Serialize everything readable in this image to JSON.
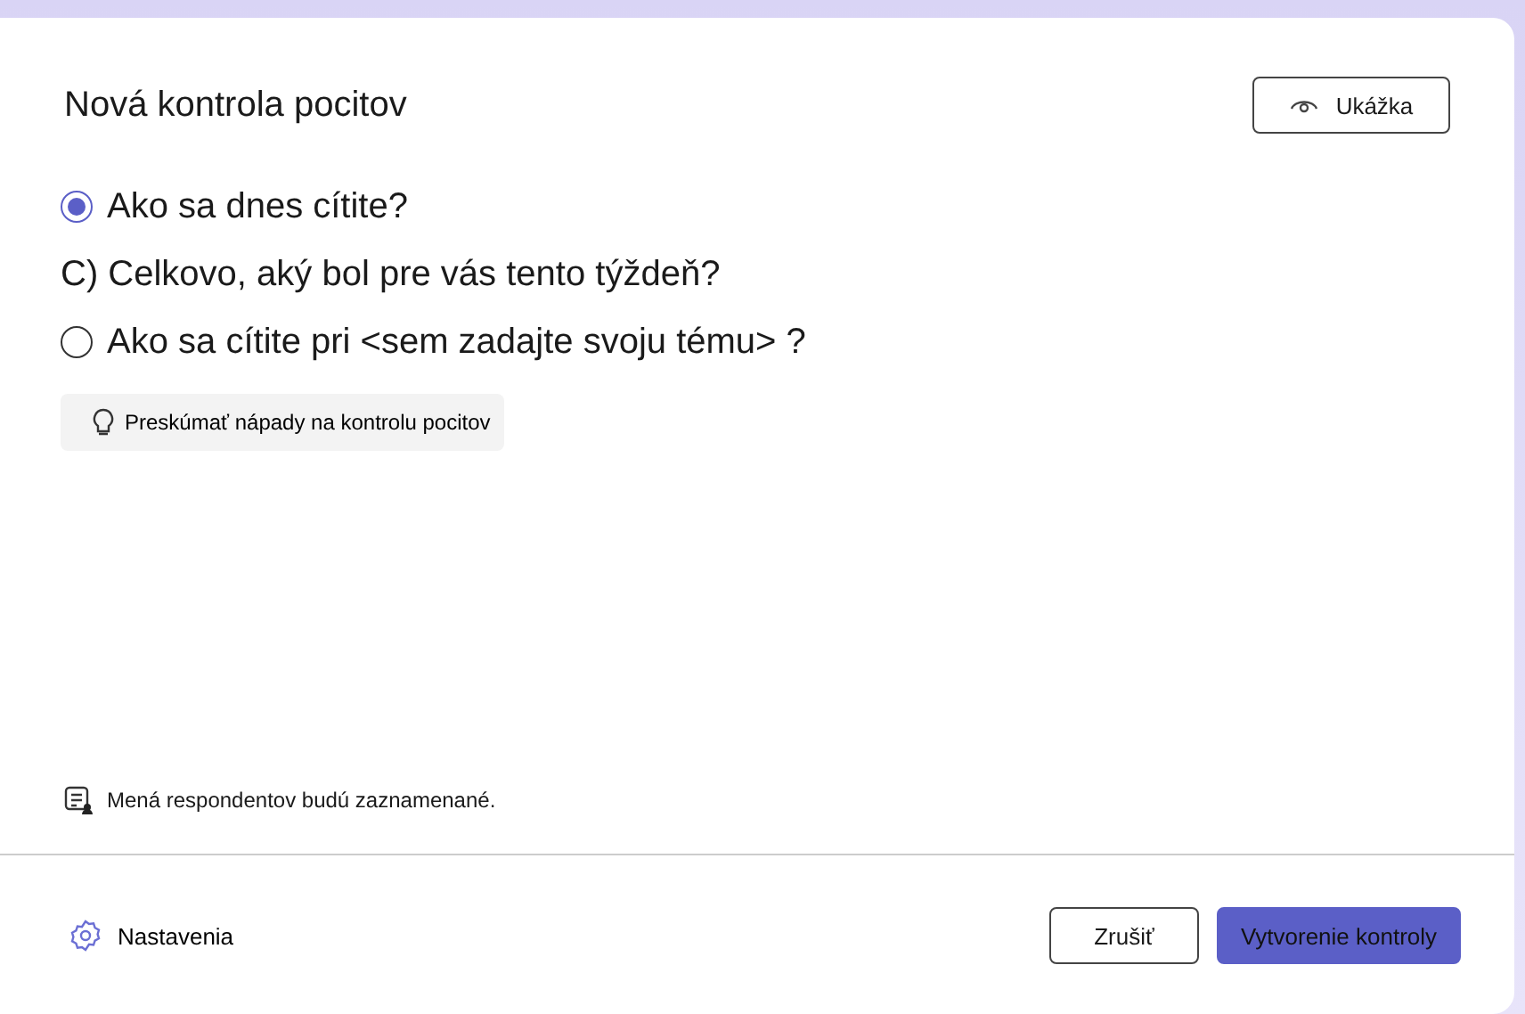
{
  "dialog": {
    "title": "Nová kontrola pocitov",
    "preview_button": "Ukážka"
  },
  "questions": [
    {
      "kind": "radio",
      "label": "Ako sa dnes cítite?",
      "selected": true
    },
    {
      "kind": "text",
      "label": "C) Celkovo, aký bol pre vás tento týždeň?"
    },
    {
      "kind": "radio",
      "label": "Ako sa cítite pri <sem zadajte svoju tému> ?",
      "selected": false
    }
  ],
  "ideas_button": "Preskúmať nápady na kontrolu pocitov",
  "note": "Mená respondentov budú zaznamenané.",
  "footer": {
    "settings": "Nastavenia",
    "cancel": "Zrušiť",
    "create": "Vytvorenie kontroly"
  }
}
